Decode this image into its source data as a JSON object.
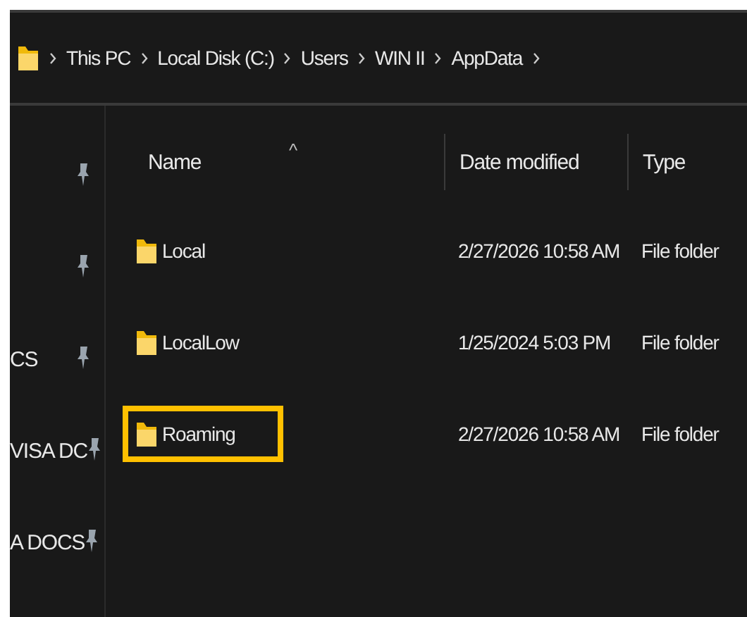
{
  "breadcrumb": [
    "This PC",
    "Local Disk (C:)",
    "Users",
    "WIN II",
    "AppData"
  ],
  "quick_access": [
    {
      "pinned": true
    },
    {
      "pinned": true
    },
    {
      "label": "CS",
      "pinned": true
    },
    {
      "label": "VISA DC",
      "pinned": true
    },
    {
      "label": "A DOCS",
      "pinned": true
    }
  ],
  "table": {
    "sort_indicator": "^",
    "columns": [
      "Name",
      "Date modified",
      "Type"
    ],
    "rows": [
      {
        "name": "Local",
        "date_modified": "2/27/2026 10:58 AM",
        "type": "File folder",
        "highlighted": false
      },
      {
        "name": "LocalLow",
        "date_modified": "1/25/2024 5:03 PM",
        "type": "File folder",
        "highlighted": false
      },
      {
        "name": "Roaming",
        "date_modified": "2/27/2026 10:58 AM",
        "type": "File folder",
        "highlighted": true
      }
    ]
  }
}
